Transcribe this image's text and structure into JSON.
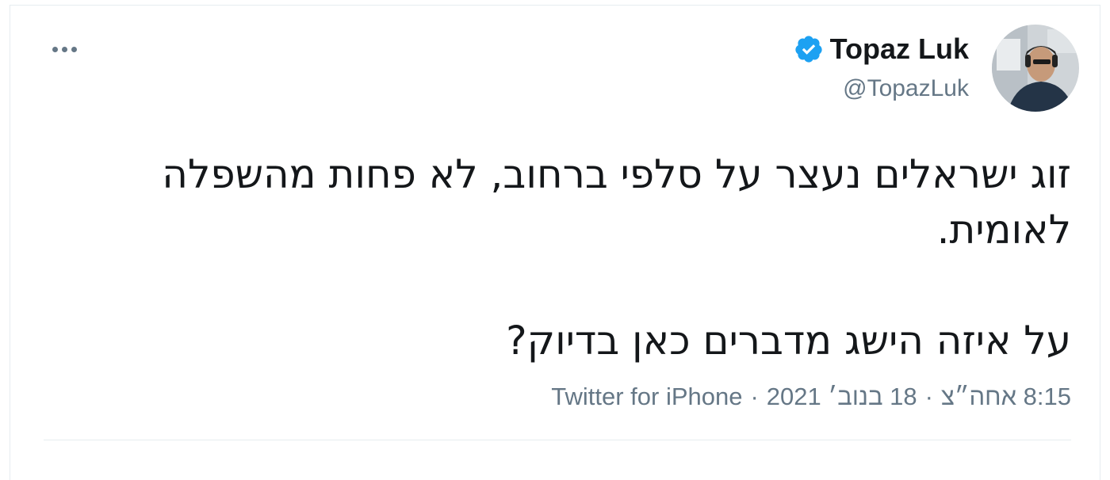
{
  "author": {
    "display_name": "Topaz Luk",
    "handle": "@TopazLuk",
    "verified": true,
    "avatar_icon": "profile-photo"
  },
  "menu": {
    "icon": "more-options-icon"
  },
  "tweet": {
    "paragraphs": [
      "זוג ישראלים נעצר על סלפי ברחוב, לא פחות מהשפלה לאומית.",
      "על איזה הישג מדברים כאן בדיוק?"
    ],
    "time": "8:15 אחה״צ",
    "date": "18 בנוב׳ 2021",
    "source": "Twitter for iPhone",
    "separator": "·"
  },
  "colors": {
    "verified_blue": "#1da1f2",
    "text_primary": "#14171a",
    "text_secondary": "#657786",
    "border": "#e6ecf0"
  }
}
